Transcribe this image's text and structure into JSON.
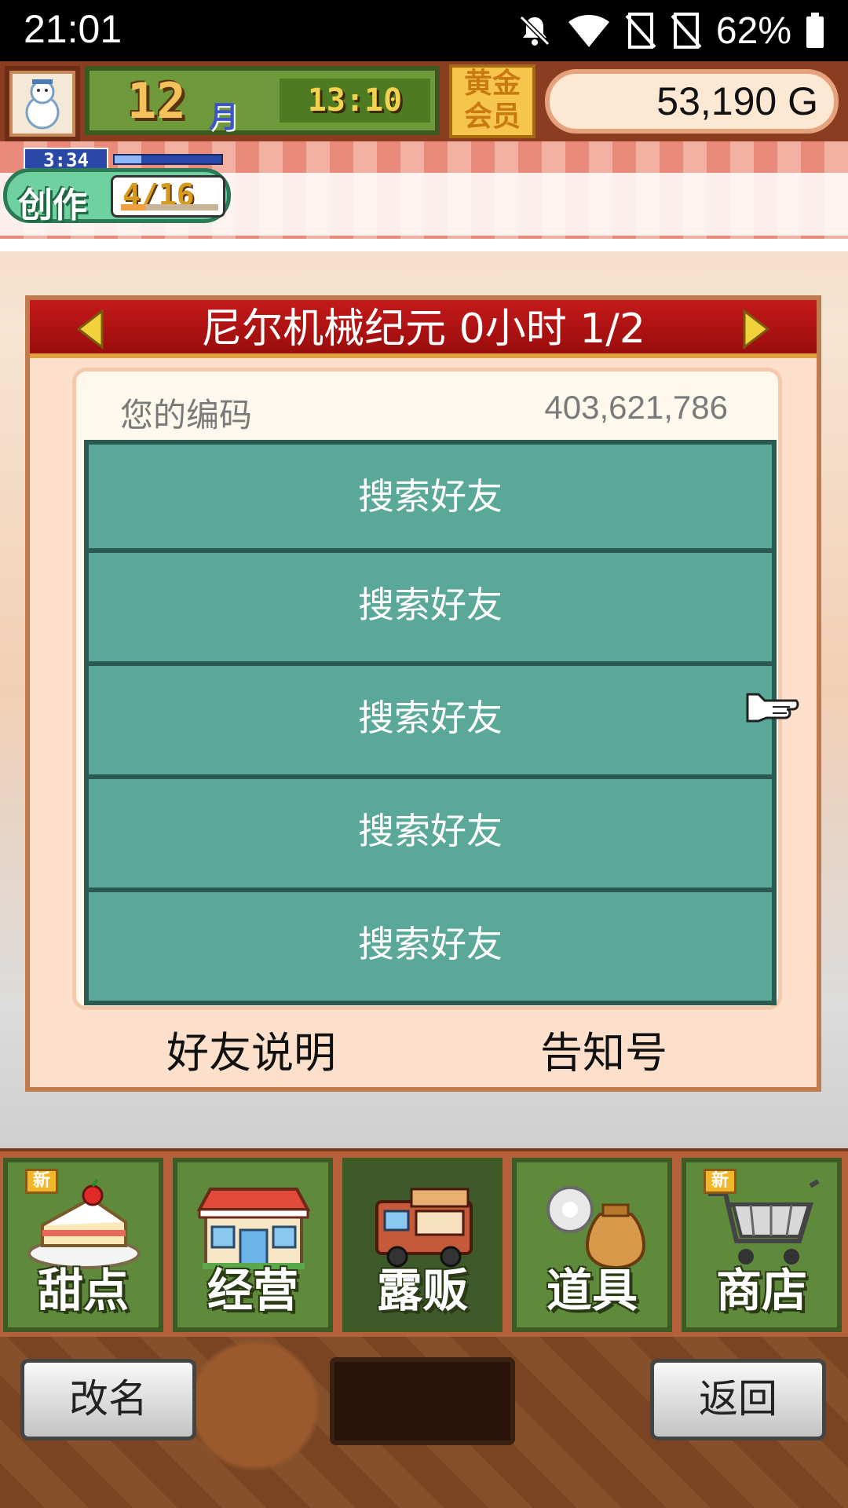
{
  "status_bar": {
    "time": "21:01",
    "battery": "62%",
    "icons": [
      "mute-icon",
      "wifi-icon",
      "no-sim-icon",
      "no-sim-icon",
      "battery-icon"
    ]
  },
  "hud": {
    "month_number": "12",
    "month_unit": "月",
    "clock": "13:10",
    "gold_member": "黄金\n会员",
    "money": "53,190 G",
    "avatar_icon": "snowman-icon"
  },
  "create": {
    "label": "创作",
    "timer": "3:34",
    "count": "4/16",
    "bar_fill": 0.25,
    "progress_fill": 0.25
  },
  "dialog": {
    "title": "尼尔机械纪元  0小时 1/2",
    "code_label": "您的编码",
    "code_value": "403,621,786",
    "friends": [
      {
        "label": "搜索好友"
      },
      {
        "label": "搜索好友"
      },
      {
        "label": "搜索好友"
      },
      {
        "label": "搜索好友"
      },
      {
        "label": "搜索好友"
      }
    ],
    "footer_left": "好友说明",
    "footer_right": "告知号"
  },
  "nav": [
    {
      "label": "甜点",
      "icon": "cake-icon",
      "new": true,
      "new_label": "新",
      "active": false
    },
    {
      "label": "经营",
      "icon": "shop-building-icon",
      "new": false,
      "active": false
    },
    {
      "label": "露贩",
      "icon": "food-truck-icon",
      "new": false,
      "active": true
    },
    {
      "label": "道具",
      "icon": "item-bag-icon",
      "new": false,
      "active": false
    },
    {
      "label": "商店",
      "icon": "shopping-cart-icon",
      "new": true,
      "new_label": "新",
      "active": false
    }
  ],
  "bottom": {
    "rename": "改名",
    "back": "返回"
  },
  "colors": {
    "dialog_header": "#c41a1a",
    "friend_button": "#5aa898",
    "nav_tile": "#5f8a3c"
  }
}
